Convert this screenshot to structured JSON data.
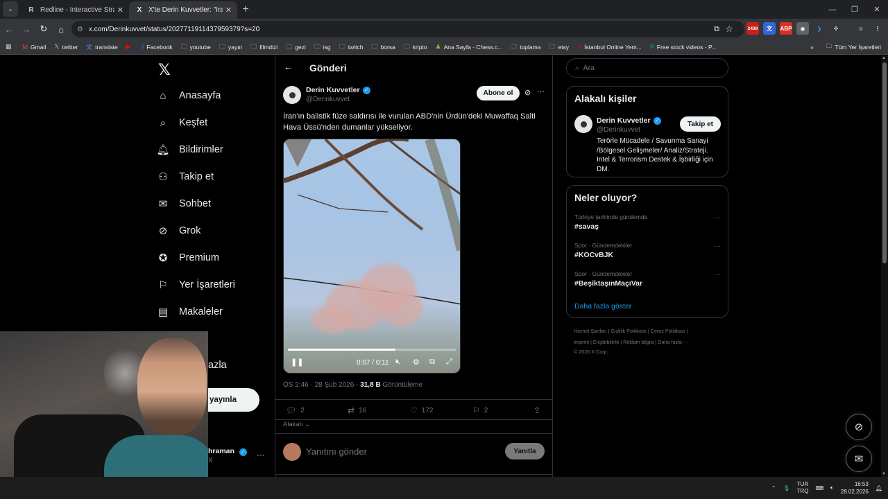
{
  "browser": {
    "tabs": [
      {
        "title": "Redline - Interactive Strategic M",
        "favicon": "R",
        "active": false
      },
      {
        "title": "X'te Derin Kuvvetler: \"İran'ın ba",
        "favicon": "X",
        "active": true
      }
    ],
    "url": "x.com/Derinkuvvet/status/2027711911437959379?s=20",
    "bookmarks": [
      "Gmail",
      "twitter",
      "translate",
      "",
      "Facebook",
      "youtube",
      "yayın",
      "filmdizi",
      "gezi",
      "isg",
      "twitch",
      "borsa",
      "kripto",
      "Ana Sayfa - Chess.c...",
      "toplama",
      "etsy",
      "İstanbul Online Yem...",
      "Free stock videos - P..."
    ],
    "bookmarks_all": "Tüm Yer İşaretleri",
    "extension_badge": "2438"
  },
  "nav": {
    "items": [
      {
        "label": "Anasayfa",
        "icon": "home-icon"
      },
      {
        "label": "Keşfet",
        "icon": "search-icon"
      },
      {
        "label": "Bildirimler",
        "icon": "bell-icon"
      },
      {
        "label": "Takip et",
        "icon": "add-user-icon"
      },
      {
        "label": "Sohbet",
        "icon": "mail-icon"
      },
      {
        "label": "Grok",
        "icon": "grok-icon"
      },
      {
        "label": "Premium",
        "icon": "premium-icon"
      },
      {
        "label": "Yer İşaretleri",
        "icon": "bookmark-icon"
      },
      {
        "label": "Makaleler",
        "icon": "article-icon"
      },
      {
        "label": "azla",
        "icon": ""
      }
    ],
    "post_label": "yayınla",
    "account_name": "hraman",
    "account_handle": "X"
  },
  "post": {
    "header_title": "Gönderi",
    "author_name": "Derin Kuvvetler",
    "author_handle": "@Derinkuvvet",
    "subscribe_label": "Abone ol",
    "text": "İran'ın balistik füze saldırısı ile vurulan ABD'nin Ürdün'deki Muwaffaq Salti Hava Üssü'nden dumanlar yükseliyor.",
    "video_time": "0:07 / 0:11",
    "video_progress": 0.64,
    "time": "ÖS 2:46 · 28 Şub 2026 · ",
    "views_count": "31,8 B",
    "views_label": " Görüntüleme",
    "replies": "2",
    "reposts": "16",
    "likes": "172",
    "bookmarks": "2",
    "related_label": "Alakalı",
    "reply_placeholder": "Yanıtını gönder",
    "reply_button": "Yanıtla"
  },
  "right": {
    "search_placeholder": "Ara",
    "related_title": "Alakalı kişiler",
    "rp_name": "Derin Kuvvetler",
    "rp_handle": "@Derinkuvvet",
    "follow_label": "Takip et",
    "rp_bio": "Terörle Mücadele / Savunma Sanayi /Bölgesel Gelişmeler/ Analiz/Strateji. Intel & Terrorism Destek & İşbirliği için DM.",
    "trends_title": "Neler oluyor?",
    "trends": [
      {
        "meta": "Türkiye tarihinde gündemde",
        "tag": "#savaş"
      },
      {
        "meta": "Spor · Gündemdekiler",
        "tag": "#KOCvBJK"
      },
      {
        "meta": "Spor · Gündemdekiler",
        "tag": "#BeşiktaşınMaçıVar"
      }
    ],
    "show_more": "Daha fazla göster",
    "footer_line1": "Hizmet Şartları  |  Gizlilik Politikası  |  Çerez Politikası  |",
    "footer_line2": "Imprint  |  Erişilebilirlik  |  Reklam bilgisi  |  Daha fazla ···",
    "footer_line3": "© 2026 X Corp."
  },
  "taskbar": {
    "lang_top": "TUR",
    "lang_bottom": "TRQ",
    "time": "16:53",
    "date": "28.02.2026"
  }
}
